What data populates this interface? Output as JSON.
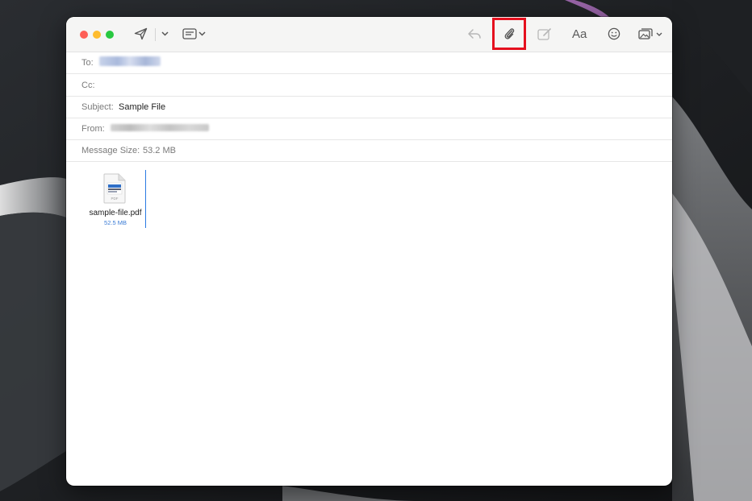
{
  "window": {
    "toolbar": {
      "icons": [
        "send-icon",
        "chevron-down-icon",
        "header-fields-icon",
        "reply-icon",
        "paperclip-icon",
        "markup-icon",
        "format-text-icon",
        "emoji-icon",
        "photo-browser-icon"
      ],
      "format_label": "Aa",
      "highlight_color": "#e5101e"
    },
    "headers": {
      "to_label": "To:",
      "cc_label": "Cc:",
      "subject_label": "Subject:",
      "subject_value": "Sample File",
      "from_label": "From:",
      "size_label": "Message Size:",
      "size_value": "53.2 MB"
    },
    "attachment": {
      "badge": "PDF",
      "name": "sample-file.pdf",
      "size": "52.5 MB",
      "size_color": "#3a7bd5"
    }
  }
}
